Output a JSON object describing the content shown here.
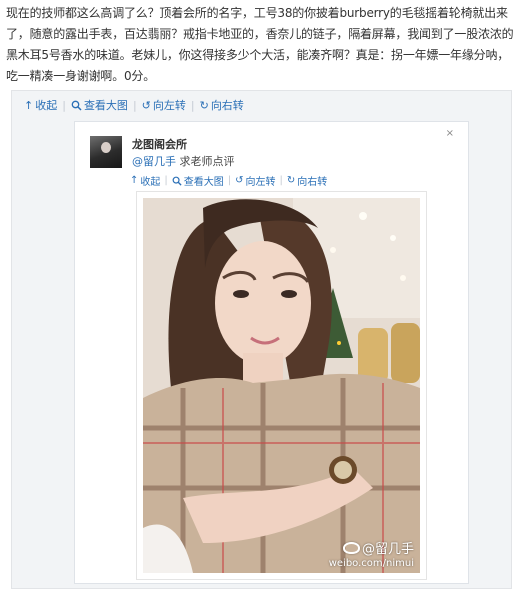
{
  "post": {
    "text": "现在的技师都这么高调了么？顶着会所的名字，工号38的你披着burberry的毛毯摇着轮椅就出来了，随意的露出手表，百达翡丽？戒指卡地亚的，香奈儿的链子，隔着屏幕，我闻到了一股浓浓的黑木耳5号香水的味道。老妹儿，你这得接多少个大活，能凑齐啊？真是：拐一年嫖一年缘分呐，吃一精凑一身谢谢啊。0分。"
  },
  "outer_toolbar": {
    "collapse": "收起",
    "view_large": "查看大图",
    "rotate_left": "向左转",
    "rotate_right": "向右转"
  },
  "repost": {
    "name": "龙图阁会所",
    "mention": "@留几手",
    "mention_text": "求老师点评",
    "close": "×"
  },
  "inner_toolbar": {
    "collapse": "收起",
    "view_large": "查看大图",
    "rotate_left": "向左转",
    "rotate_right": "向右转"
  },
  "watermark": {
    "handle": "@留几手",
    "url": "weibo.com/nimui"
  },
  "colors": {
    "link": "#2a6fb6",
    "text": "#333333",
    "panel": "#f2f4f6"
  },
  "icons": {
    "collapse": "up-arrow-icon",
    "view_large": "magnify-icon",
    "rotate_left": "rotate-left-icon",
    "rotate_right": "rotate-right-icon",
    "weibo_logo": "weibo-logo-icon"
  }
}
